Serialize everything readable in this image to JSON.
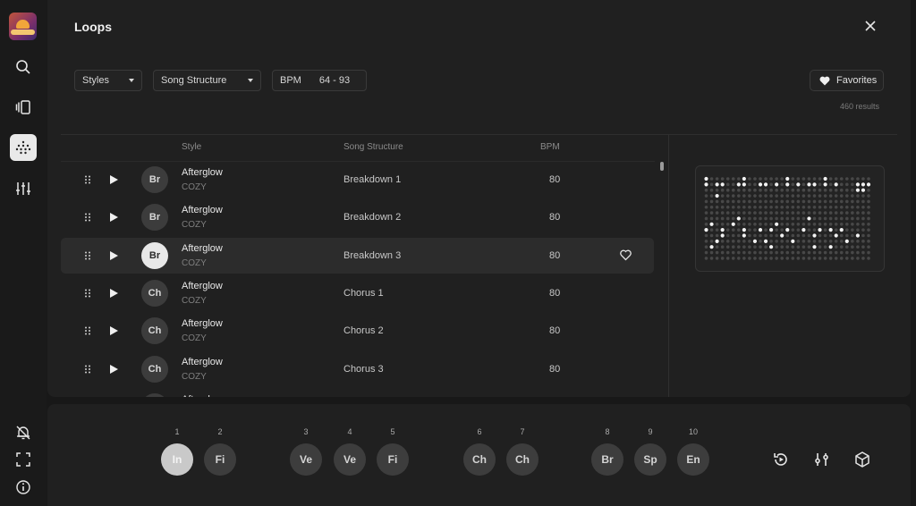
{
  "sidebar": {
    "icons": [
      "logo-icon",
      "search-icon",
      "panels-icon",
      "grid-dots-icon",
      "sliders-icon",
      "bell-off-icon",
      "fullscreen-icon",
      "info-icon"
    ],
    "active": "grid-dots-icon"
  },
  "header": {
    "title": "Loops",
    "close_icon": "close-icon"
  },
  "filters": {
    "styles_label": "Styles",
    "structure_label": "Song Structure",
    "bpm_label": "BPM",
    "bpm_range": "64 - 93",
    "favorites_label": "Favorites",
    "results": "460 results"
  },
  "table": {
    "columns": {
      "style": "Style",
      "structure": "Song Structure",
      "bpm": "BPM"
    },
    "rows": [
      {
        "badge": "Br",
        "style": "Afterglow",
        "sub": "COZY",
        "structure": "Breakdown 1",
        "bpm": "80",
        "selected": false
      },
      {
        "badge": "Br",
        "style": "Afterglow",
        "sub": "COZY",
        "structure": "Breakdown 2",
        "bpm": "80",
        "selected": false
      },
      {
        "badge": "Br",
        "style": "Afterglow",
        "sub": "COZY",
        "structure": "Breakdown 3",
        "bpm": "80",
        "selected": true
      },
      {
        "badge": "Ch",
        "style": "Afterglow",
        "sub": "COZY",
        "structure": "Chorus 1",
        "bpm": "80",
        "selected": false
      },
      {
        "badge": "Ch",
        "style": "Afterglow",
        "sub": "COZY",
        "structure": "Chorus 2",
        "bpm": "80",
        "selected": false
      },
      {
        "badge": "Ch",
        "style": "Afterglow",
        "sub": "COZY",
        "structure": "Chorus 3",
        "bpm": "80",
        "selected": false
      },
      {
        "badge": "",
        "style": "Afterglow",
        "sub": "",
        "structure": "",
        "bpm": "",
        "selected": false
      }
    ]
  },
  "pattern": {
    "active_cells": [
      [
        0,
        0
      ],
      [
        0,
        7
      ],
      [
        0,
        15
      ],
      [
        0,
        22
      ],
      [
        1,
        0
      ],
      [
        1,
        2
      ],
      [
        1,
        3
      ],
      [
        1,
        6
      ],
      [
        1,
        7
      ],
      [
        1,
        10
      ],
      [
        1,
        11
      ],
      [
        1,
        13
      ],
      [
        1,
        15
      ],
      [
        1,
        17
      ],
      [
        1,
        19
      ],
      [
        1,
        20
      ],
      [
        1,
        22
      ],
      [
        1,
        24
      ],
      [
        1,
        28
      ],
      [
        1,
        29
      ],
      [
        1,
        30
      ],
      [
        2,
        28
      ],
      [
        2,
        29
      ],
      [
        3,
        2
      ],
      [
        7,
        6
      ],
      [
        7,
        19
      ],
      [
        8,
        1
      ],
      [
        8,
        5
      ],
      [
        8,
        13
      ],
      [
        9,
        0
      ],
      [
        9,
        3
      ],
      [
        9,
        7
      ],
      [
        9,
        10
      ],
      [
        9,
        12
      ],
      [
        9,
        15
      ],
      [
        9,
        18
      ],
      [
        9,
        21
      ],
      [
        9,
        23
      ],
      [
        9,
        25
      ],
      [
        10,
        3
      ],
      [
        10,
        7
      ],
      [
        10,
        14
      ],
      [
        10,
        20
      ],
      [
        10,
        24
      ],
      [
        10,
        28
      ],
      [
        11,
        2
      ],
      [
        11,
        9
      ],
      [
        11,
        11
      ],
      [
        11,
        16
      ],
      [
        11,
        26
      ],
      [
        12,
        1
      ],
      [
        12,
        12
      ],
      [
        12,
        20
      ],
      [
        12,
        23
      ]
    ]
  },
  "timeline": {
    "segments": [
      {
        "num": "1",
        "label": "In",
        "active": true
      },
      {
        "num": "2",
        "label": "Fi",
        "active": false
      },
      {
        "num": "3",
        "label": "Ve",
        "active": false
      },
      {
        "num": "4",
        "label": "Ve",
        "active": false
      },
      {
        "num": "5",
        "label": "Fi",
        "active": false
      },
      {
        "num": "6",
        "label": "Ch",
        "active": false
      },
      {
        "num": "7",
        "label": "Ch",
        "active": false
      },
      {
        "num": "8",
        "label": "Br",
        "active": false
      },
      {
        "num": "9",
        "label": "Sp",
        "active": false
      },
      {
        "num": "10",
        "label": "En",
        "active": false
      }
    ],
    "tools": [
      "replay-icon",
      "adjust-icon",
      "cube-icon"
    ]
  }
}
